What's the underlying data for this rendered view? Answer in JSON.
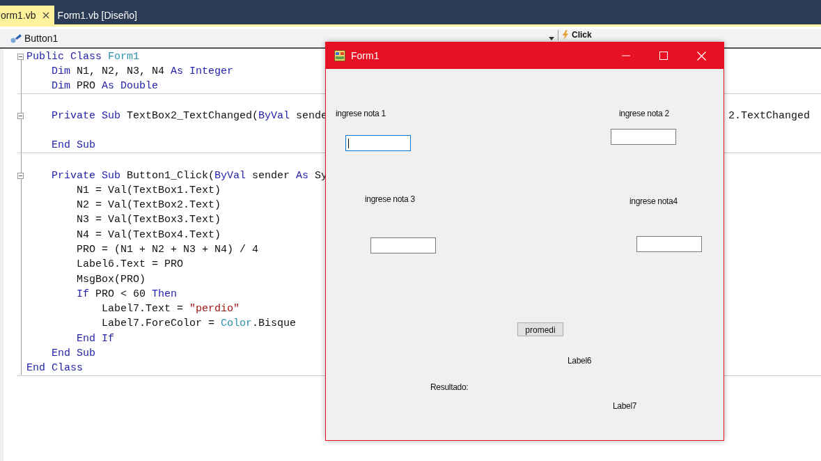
{
  "tabs": [
    {
      "label": "orm1.vb",
      "selected": true,
      "closable": true
    },
    {
      "label": "Form1.vb [Diseño]",
      "selected": false,
      "closable": false
    }
  ],
  "navigation_bar": {
    "object": "Button1",
    "member": "Click"
  },
  "code_lines": [
    {
      "kind": "code",
      "fold": true,
      "separator_after": false,
      "tokens": [
        {
          "kind": "keyword",
          "text": "Public Class "
        },
        {
          "kind": "type",
          "text": "Form1"
        }
      ]
    },
    {
      "kind": "code",
      "fold": false,
      "separator_after": false,
      "tokens": [
        {
          "kind": "keyword",
          "text": "    Dim"
        },
        {
          "kind": "plain",
          "text": " N1, N2, N3, N4 "
        },
        {
          "kind": "keyword",
          "text": "As Integer"
        }
      ]
    },
    {
      "kind": "code",
      "fold": false,
      "separator_after": true,
      "tokens": [
        {
          "kind": "keyword",
          "text": "    Dim"
        },
        {
          "kind": "plain",
          "text": " PRO "
        },
        {
          "kind": "keyword",
          "text": "As Double"
        }
      ]
    },
    {
      "kind": "blank",
      "fold": false,
      "separator_after": false
    },
    {
      "kind": "code",
      "fold": true,
      "separator_after": false,
      "tokens": [
        {
          "kind": "keyword",
          "text": "    Private Sub"
        },
        {
          "kind": "plain",
          "text": " TextBox2_TextChanged("
        },
        {
          "kind": "keyword",
          "text": "ByVal"
        },
        {
          "kind": "plain",
          "text": " sende"
        }
      ],
      "tail": "2.TextChanged"
    },
    {
      "kind": "blank",
      "fold": false,
      "separator_after": false
    },
    {
      "kind": "code",
      "fold": false,
      "separator_after": true,
      "tokens": [
        {
          "kind": "keyword",
          "text": "    End Sub"
        }
      ]
    },
    {
      "kind": "blank",
      "fold": false,
      "separator_after": false
    },
    {
      "kind": "code",
      "fold": true,
      "separator_after": false,
      "tokens": [
        {
          "kind": "keyword",
          "text": "    Private Sub"
        },
        {
          "kind": "plain",
          "text": " Button1_Click("
        },
        {
          "kind": "keyword",
          "text": "ByVal"
        },
        {
          "kind": "plain",
          "text": " sender "
        },
        {
          "kind": "keyword",
          "text": "As"
        },
        {
          "kind": "plain",
          "text": " Sy"
        }
      ]
    },
    {
      "kind": "code",
      "fold": false,
      "separator_after": false,
      "tokens": [
        {
          "kind": "plain",
          "text": "        N1 = Val(TextBox1.Text)"
        }
      ]
    },
    {
      "kind": "code",
      "fold": false,
      "separator_after": false,
      "tokens": [
        {
          "kind": "plain",
          "text": "        N2 = Val(TextBox2.Text)"
        }
      ]
    },
    {
      "kind": "code",
      "fold": false,
      "separator_after": false,
      "tokens": [
        {
          "kind": "plain",
          "text": "        N3 = Val(TextBox3.Text)"
        }
      ]
    },
    {
      "kind": "code",
      "fold": false,
      "separator_after": false,
      "tokens": [
        {
          "kind": "plain",
          "text": "        N4 = Val(TextBox4.Text)"
        }
      ]
    },
    {
      "kind": "code",
      "fold": false,
      "separator_after": false,
      "tokens": [
        {
          "kind": "plain",
          "text": "        PRO = (N1 + N2 + N3 + N4) / 4"
        }
      ]
    },
    {
      "kind": "code",
      "fold": false,
      "separator_after": false,
      "tokens": [
        {
          "kind": "plain",
          "text": "        Label6.Text = PRO"
        }
      ]
    },
    {
      "kind": "code",
      "fold": false,
      "separator_after": false,
      "tokens": [
        {
          "kind": "plain",
          "text": "        MsgBox(PRO)"
        }
      ]
    },
    {
      "kind": "code",
      "fold": false,
      "separator_after": false,
      "tokens": [
        {
          "kind": "keyword",
          "text": "        If"
        },
        {
          "kind": "plain",
          "text": " PRO < 60 "
        },
        {
          "kind": "keyword",
          "text": "Then"
        }
      ]
    },
    {
      "kind": "code",
      "fold": false,
      "separator_after": false,
      "tokens": [
        {
          "kind": "plain",
          "text": "            Label7.Text = "
        },
        {
          "kind": "string",
          "text": "\"perdio\""
        }
      ]
    },
    {
      "kind": "code",
      "fold": false,
      "separator_after": false,
      "tokens": [
        {
          "kind": "plain",
          "text": "            Label7.ForeColor = "
        },
        {
          "kind": "type",
          "text": "Color"
        },
        {
          "kind": "plain",
          "text": ".Bisque"
        }
      ]
    },
    {
      "kind": "code",
      "fold": false,
      "separator_after": false,
      "tokens": [
        {
          "kind": "keyword",
          "text": "        End If"
        }
      ]
    },
    {
      "kind": "code",
      "fold": false,
      "separator_after": false,
      "tokens": [
        {
          "kind": "keyword",
          "text": "    End Sub"
        }
      ]
    },
    {
      "kind": "code",
      "fold": false,
      "separator_after": true,
      "tokens": [
        {
          "kind": "keyword",
          "text": "End Class"
        }
      ]
    }
  ],
  "form_window": {
    "title": "Form1",
    "controls": [
      {
        "kind": "label",
        "text": "ingrese nota 1"
      },
      {
        "kind": "textbox",
        "focused": true
      },
      {
        "kind": "label",
        "text": "ingrese nota 2"
      },
      {
        "kind": "textbox",
        "focused": false
      },
      {
        "kind": "label",
        "text": "ingrese nota 3"
      },
      {
        "kind": "label",
        "text": "ingrese nota4"
      },
      {
        "kind": "textbox",
        "focused": false
      },
      {
        "kind": "textbox",
        "focused": false
      },
      {
        "kind": "button",
        "text": "promedi"
      },
      {
        "kind": "label",
        "text": "Label6"
      },
      {
        "kind": "label",
        "text": "Resultado:"
      },
      {
        "kind": "label",
        "text": "Label7"
      }
    ]
  }
}
